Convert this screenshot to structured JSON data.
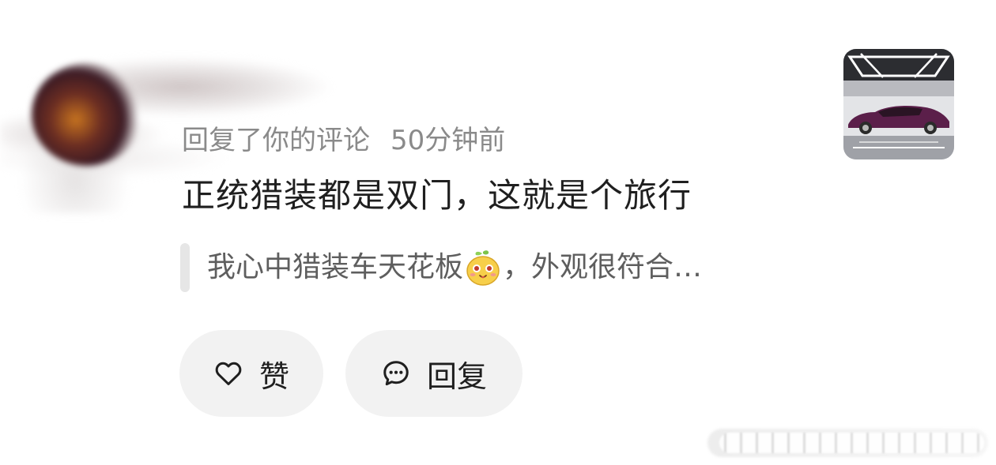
{
  "comment_card": {
    "meta": {
      "action": "回复了你的评论",
      "time": "50分钟前"
    },
    "reply_text": "正统猎装都是双门，这就是个旅行",
    "quoted": {
      "text_before_emoji": "我心中猎装车天花板",
      "emoji": "mango-face-emoji",
      "text_after_emoji": "，外观很符合…"
    },
    "thumbnail": "purple-shooting-brake-car-photo",
    "actions": {
      "like_label": "赞",
      "reply_label": "回复"
    }
  },
  "icons": {
    "like": "heart-outline-icon",
    "reply": "chat-bubble-icon"
  },
  "colors": {
    "meta_text": "#8a8a8a",
    "quote_text": "#5e5e5e",
    "button_bg": "#f2f2f2",
    "quote_bar": "#e6e6e6",
    "car": "#5b1f4a"
  }
}
